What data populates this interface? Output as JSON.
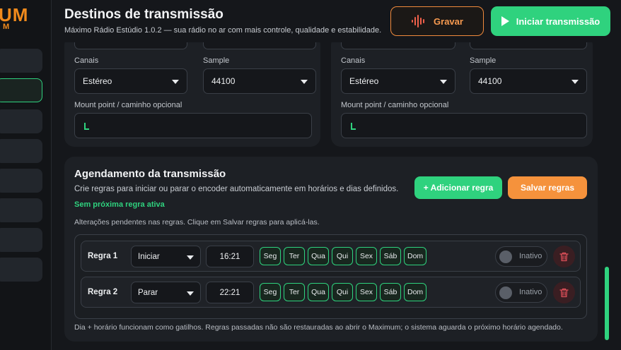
{
  "brand": {
    "logo_main": "UM",
    "logo_sub": "M"
  },
  "header": {
    "title": "Destinos de transmissão",
    "subtitle": "Máximo Rádio Estúdio 1.0.2 — sua rádio no ar com mais controle, qualidade e estabilidade.",
    "record_label": "Gravar",
    "start_label": "Iniciar transmissão"
  },
  "destinations": [
    {
      "channels_label": "Canais",
      "channels_value": "Estéreo",
      "sample_label": "Sample",
      "sample_value": "44100",
      "mount_label": "Mount point / caminho opcional",
      "mount_value": ""
    },
    {
      "channels_label": "Canais",
      "channels_value": "Estéreo",
      "sample_label": "Sample",
      "sample_value": "44100",
      "mount_label": "Mount point / caminho opcional",
      "mount_value": ""
    }
  ],
  "schedule": {
    "title": "Agendamento da transmissão",
    "description": "Crie regras para iniciar ou parar o encoder automaticamente em horários e dias definidos.",
    "next_rule": "Sem próxima regra ativa",
    "pending": "Alterações pendentes nas regras. Clique em Salvar regras para aplicá-las.",
    "add_label": "+ Adicionar regra",
    "save_label": "Salvar regras",
    "footer": "Dia + horário funcionam como gatilhos. Regras passadas não são restauradas ao abrir o Maximum; o sistema aguarda o próximo horário agendado.",
    "rules": [
      {
        "name": "Regra 1",
        "action": "Iniciar",
        "time": "16:21",
        "days": [
          "Seg",
          "Ter",
          "Qua",
          "Qui",
          "Sex",
          "Sáb",
          "Dom"
        ],
        "status": "Inativo"
      },
      {
        "name": "Regra 2",
        "action": "Parar",
        "time": "22:21",
        "days": [
          "Seg",
          "Ter",
          "Qua",
          "Qui",
          "Sex",
          "Sáb",
          "Dom"
        ],
        "status": "Inativo"
      }
    ]
  },
  "colors": {
    "accent_green": "#2fd27e",
    "accent_orange": "#f5923c",
    "record_red": "#f0604a"
  },
  "icons": [
    "sound-wave-icon",
    "play-icon",
    "cursor-icon",
    "chevron-down-icon",
    "trash-icon"
  ]
}
